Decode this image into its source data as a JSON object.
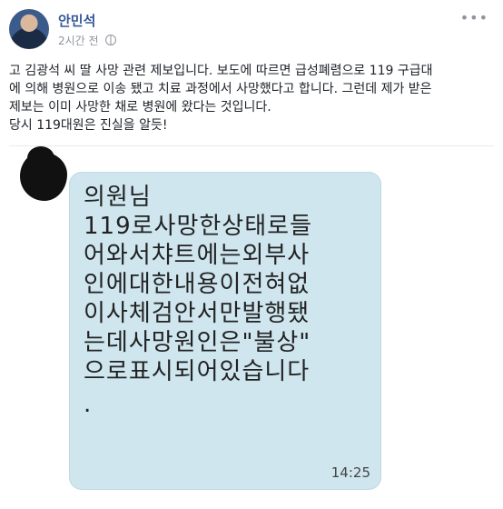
{
  "post": {
    "author": "안민석",
    "timestamp": "2시간 전",
    "privacy_icon": "globe-icon",
    "more_icon": "ellipsis-icon",
    "text": [
      "고 김광석 씨 딸 사망 관련 제보입니다. 보도에 따르면 급성폐렴으로 119 구급대",
      "에 의해 병원으로 이송 됐고 치료 과정에서 사망했다고 합니다. 그런데 제가 받은",
      "제보는 이미 사망한 채로 병원에 왔다는 것입니다.",
      "당시 119대원은 진실을 알듯!"
    ]
  },
  "image": {
    "message_lines": [
      "의원님",
      "119로사망한상태로들",
      "어와서챠트에는외부사",
      "인에대한내용이전혀없",
      "이사체검안서만발행됐",
      "는데사망원인은\"불상\"",
      "으로표시되어있습니다",
      "."
    ],
    "time": "14:25",
    "bubble_color": "#cfe6ef"
  },
  "colors": {
    "author": "#365899",
    "meta": "#90949c"
  }
}
